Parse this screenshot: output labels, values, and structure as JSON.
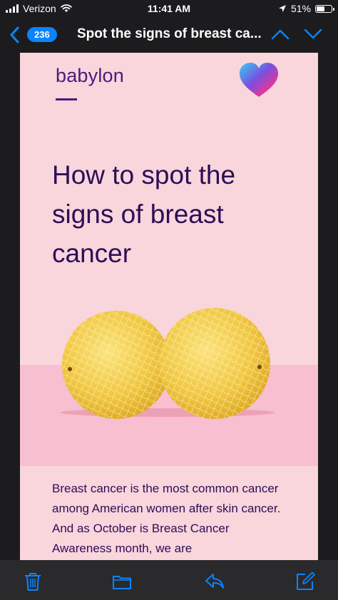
{
  "status_bar": {
    "carrier": "Verizon",
    "time": "11:41 AM",
    "battery": "51%",
    "battery_level": 0.51
  },
  "nav": {
    "back_icon": "chevron-left-icon",
    "unread_count": "236",
    "title": "Spot the signs of breast ca...",
    "prev_icon": "chevron-up-icon",
    "next_icon": "chevron-down-icon"
  },
  "email": {
    "brand": "babylon",
    "brand_icon": "heart-icon",
    "headline": "How to spot the signs of breast cancer",
    "image_subject": "two melons",
    "body": "Breast cancer is the most common cancer among American women after skin cancer. And as October is Breast Cancer Awareness month, we are"
  },
  "toolbar": {
    "items": [
      "trash-icon",
      "folder-icon",
      "reply-icon",
      "compose-icon"
    ]
  },
  "colors": {
    "accent": "#0a84ff",
    "email_background": "#f9d5dc",
    "brand_purple": "#4b1a7a",
    "headline": "#2c0e56"
  }
}
